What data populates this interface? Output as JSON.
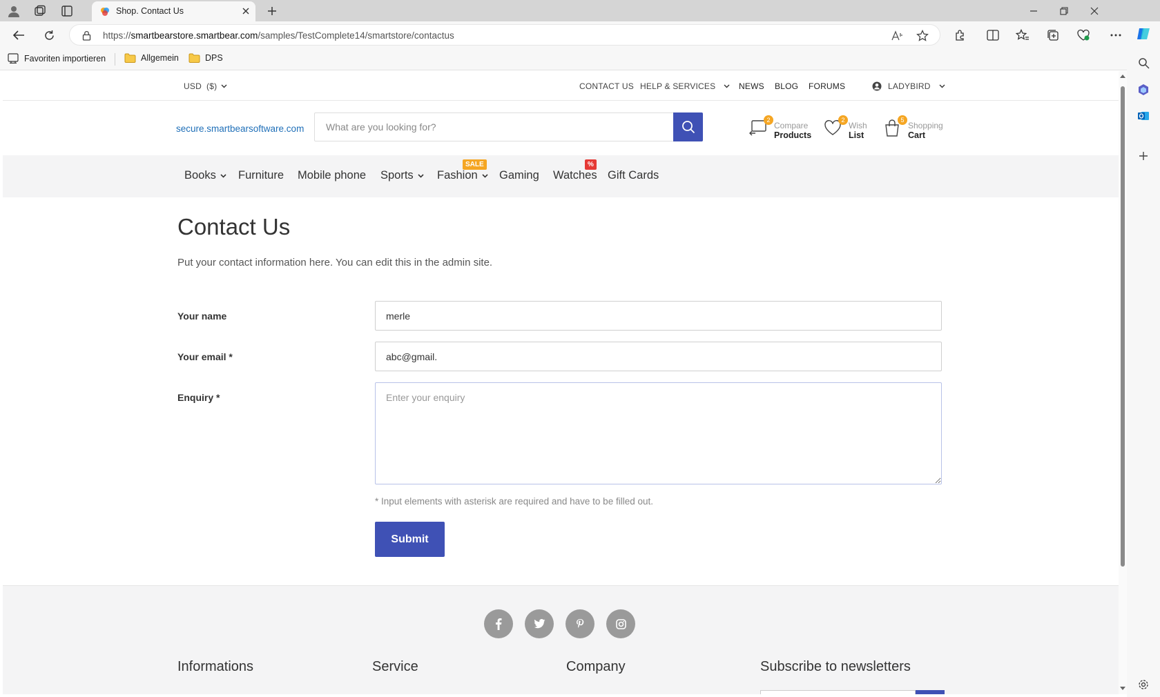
{
  "browser": {
    "tab_title": "Shop. Contact Us",
    "url_prefix": "https://",
    "url_host": "smartbearstore.smartbear.com",
    "url_path": "/samples/TestComplete14/smartstore/contactus",
    "bookmarks": [
      {
        "label": "Favoriten importieren",
        "icon": "import-favorites-icon"
      },
      {
        "label": "Allgemein",
        "icon": "folder-icon"
      },
      {
        "label": "DPS",
        "icon": "folder-icon"
      }
    ]
  },
  "topbar": {
    "currency": "USD  ($)",
    "links": [
      "CONTACT US",
      "HELP & SERVICES",
      "NEWS",
      "BLOG",
      "FORUMS"
    ],
    "account": "LADYBIRD"
  },
  "header": {
    "logo_text": "secure.smartbearsoftware.com",
    "search_placeholder": "What are you looking for?",
    "compare": {
      "line1": "Compare",
      "line2": "Products",
      "count": "2"
    },
    "wishlist": {
      "line1": "Wish",
      "line2": "List",
      "count": "2"
    },
    "cart": {
      "line1": "Shopping",
      "line2": "Cart",
      "count": "5"
    }
  },
  "categories": [
    {
      "label": "Books",
      "dropdown": true
    },
    {
      "label": "Furniture",
      "dropdown": false
    },
    {
      "label": "Mobile phone",
      "dropdown": false
    },
    {
      "label": "Sports",
      "dropdown": true
    },
    {
      "label": "Fashion",
      "dropdown": true,
      "badge": "SALE"
    },
    {
      "label": "Gaming",
      "dropdown": false
    },
    {
      "label": "Watches",
      "dropdown": false,
      "badge": "%"
    },
    {
      "label": "Gift Cards",
      "dropdown": false
    }
  ],
  "colors": {
    "accent": "#3f51b5",
    "badge_sale": "#f5a623",
    "badge_percent": "#e53935",
    "link": "#1f6fb8"
  },
  "contact": {
    "title": "Contact Us",
    "intro": "Put your contact information here. You can edit this in the admin site.",
    "name_label": "Your name",
    "name_value": "merle",
    "email_label": "Your email *",
    "email_value": "abc@gmail.",
    "enquiry_label": "Enquiry *",
    "enquiry_placeholder": "Enter your enquiry",
    "required_note": "* Input elements with asterisk are required and have to be filled out.",
    "submit_label": "Submit"
  },
  "footer": {
    "social": [
      "facebook-icon",
      "twitter-icon",
      "pinterest-icon",
      "instagram-icon"
    ],
    "headings": [
      "Informations",
      "Service",
      "Company",
      "Subscribe to newsletters"
    ]
  }
}
